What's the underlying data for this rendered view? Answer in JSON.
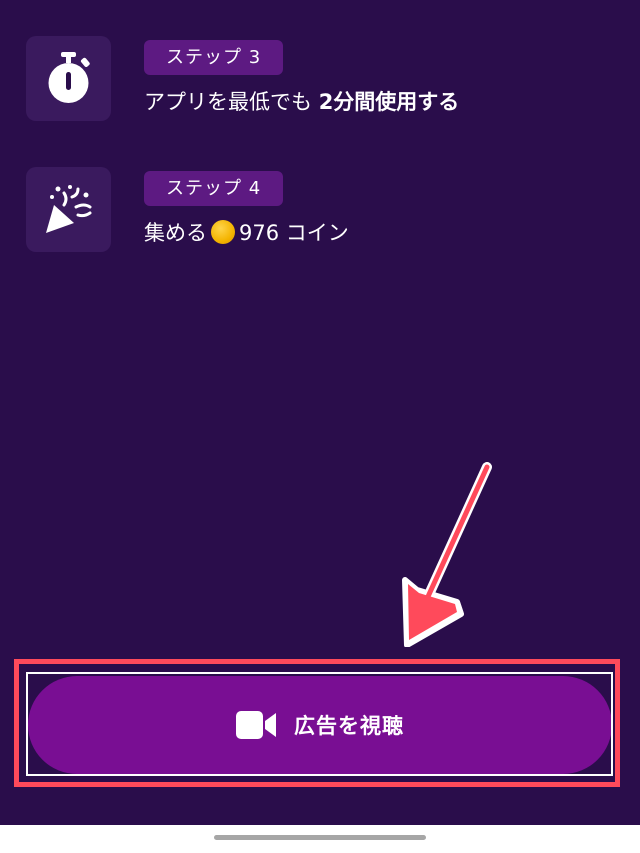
{
  "steps": [
    {
      "badge": "ステップ 3",
      "icon": "stopwatch-icon",
      "text_prefix": "アプリを最低でも ",
      "text_strong": "2分間使用する"
    },
    {
      "badge": "ステップ 4",
      "icon": "party-popper-icon",
      "text_prefix": "集める",
      "coin_icon": "coin-icon",
      "text_suffix": "976 コイン"
    }
  ],
  "action_button": {
    "icon": "video-camera-icon",
    "label": "広告を視聴"
  },
  "colors": {
    "background": "#2a0d4b",
    "icon_box": "#3a1a5e",
    "badge": "#5d1a82",
    "button": "#790e93",
    "highlight": "#ff4a5b",
    "arrow": "#ff4a5b"
  }
}
